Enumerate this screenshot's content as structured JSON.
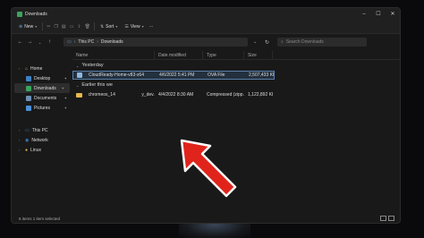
{
  "window": {
    "tab_title": "Downloads"
  },
  "toolbar": {
    "new_label": "New",
    "sort_label": "Sort",
    "view_label": "View",
    "more_label": "···"
  },
  "address": {
    "segments": [
      "This PC",
      "Downloads"
    ],
    "search_placeholder": "Search Downloads"
  },
  "sidebar": {
    "items": [
      {
        "label": "Home",
        "icon": "home-icon",
        "color": "#e8b84a"
      },
      {
        "label": "Desktop",
        "icon": "desktop-icon",
        "color": "#3b82c4"
      },
      {
        "label": "Downloads",
        "icon": "downloads-icon",
        "color": "#3aa55d"
      },
      {
        "label": "Documents",
        "icon": "documents-icon",
        "color": "#6b8fb5"
      },
      {
        "label": "Pictures",
        "icon": "pictures-icon",
        "color": "#4a90d9"
      },
      {
        "label": "This PC",
        "icon": "this-pc-icon",
        "color": "#3b82c4"
      },
      {
        "label": "Network",
        "icon": "network-icon",
        "color": "#3b82c4"
      },
      {
        "label": "Linux",
        "icon": "linux-icon",
        "color": "#e8b84a"
      }
    ]
  },
  "columns": {
    "name": "Name",
    "date": "Date modified",
    "type": "Type",
    "size": "Size"
  },
  "groups": {
    "yesterday": "Yesterday",
    "earlier": "Earlier this we"
  },
  "files": [
    {
      "name": "CloudReady-Home-v83-x64",
      "date": "4/6/2022 5:41 PM",
      "type": "OVA File",
      "size": "2,507,433 KB"
    },
    {
      "name": "chromeos_1415",
      "name_tail": "y_dev...",
      "date": "4/4/2022 8:30 AM",
      "type": "Compressed (zipp...",
      "size": "1,122,892 KB"
    }
  ],
  "status": {
    "left": "6 items   1 item selected"
  },
  "colors": {
    "accent": "#5a7fa8",
    "arrow": "#e0241c"
  }
}
